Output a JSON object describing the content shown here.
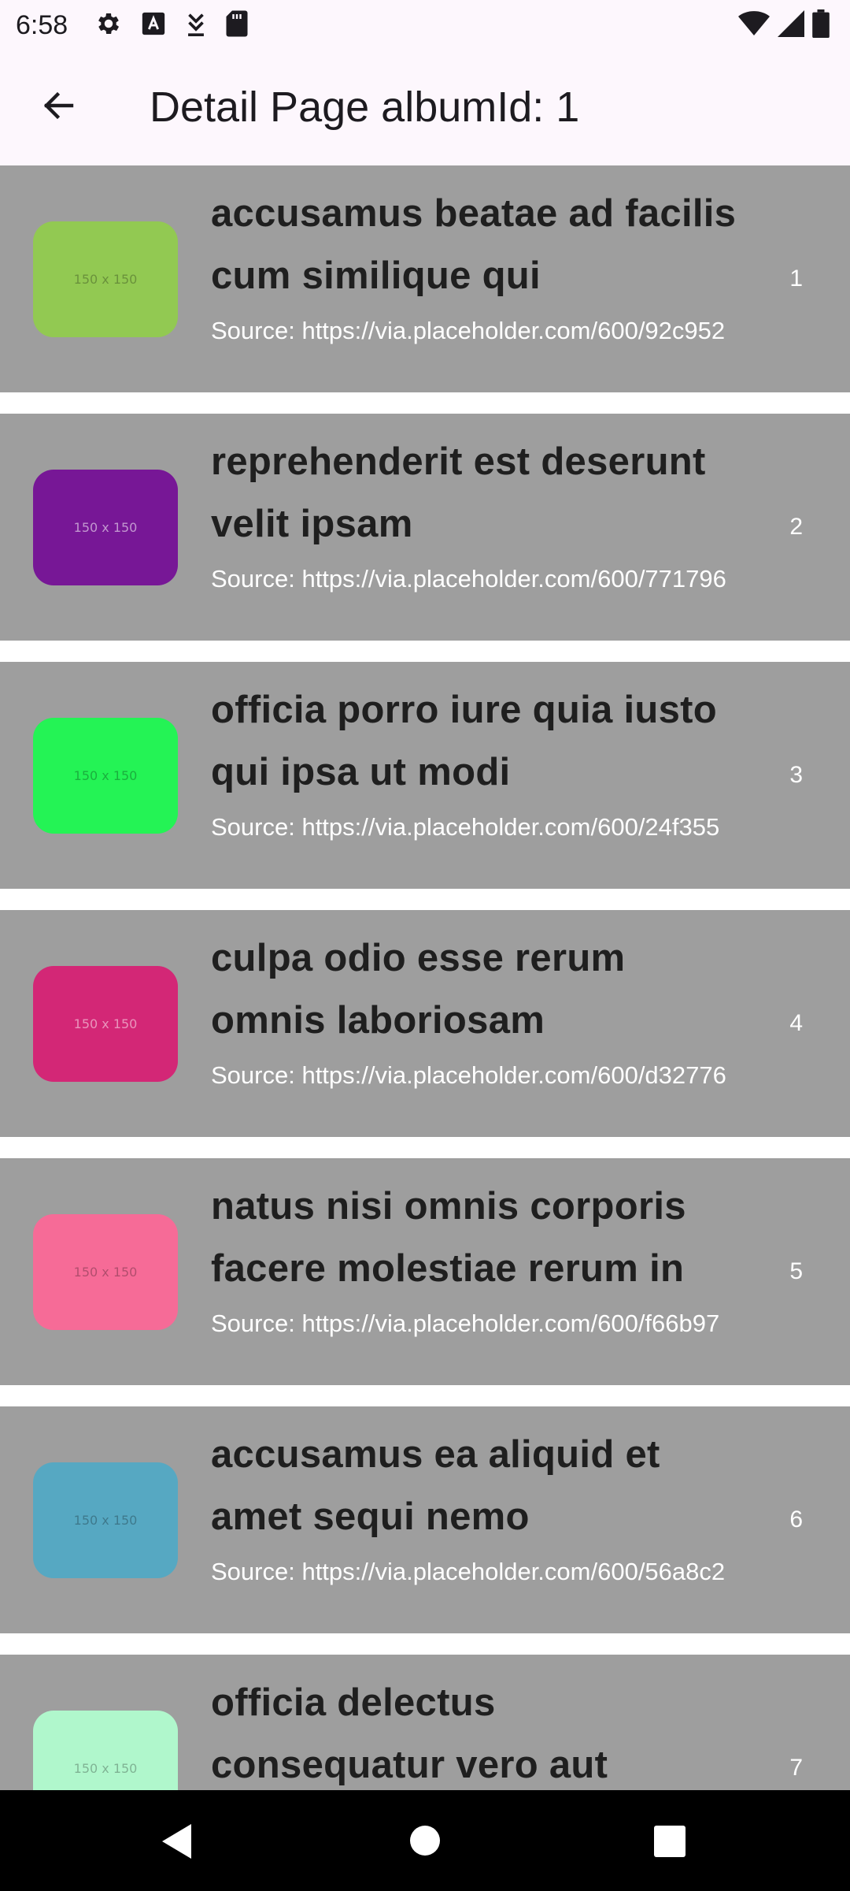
{
  "status_bar": {
    "time": "6:58",
    "left_icons": [
      "settings-icon",
      "font-icon",
      "download-icon",
      "sd-card-icon"
    ],
    "right_icons": [
      "wifi-icon",
      "signal-icon",
      "battery-icon"
    ]
  },
  "app_bar": {
    "title": "Detail Page albumId: 1",
    "back_icon": "arrow-left-icon"
  },
  "items": [
    {
      "title": "accusamus beatae ad facilis cum similique qui",
      "source": "Source: https://via.placeholder.com/600/92c952",
      "number": "1",
      "thumb_color": "#92c952",
      "thumb_text": "150 x 150"
    },
    {
      "title": "reprehenderit est deserunt velit ipsam",
      "source": "Source: https://via.placeholder.com/600/771796",
      "number": "2",
      "thumb_color": "#771796",
      "thumb_text": "150 x 150"
    },
    {
      "title": "officia porro iure quia iusto qui ipsa ut modi",
      "source": "Source: https://via.placeholder.com/600/24f355",
      "number": "3",
      "thumb_color": "#24f355",
      "thumb_text": "150 x 150"
    },
    {
      "title": "culpa odio esse rerum omnis laboriosam",
      "source": "Source: https://via.placeholder.com/600/d32776",
      "number": "4",
      "thumb_color": "#d32776",
      "thumb_text": "150 x 150"
    },
    {
      "title": "natus nisi omnis corporis facere molestiae rerum in",
      "source": "Source: https://via.placeholder.com/600/f66b97",
      "number": "5",
      "thumb_color": "#f66b97",
      "thumb_text": "150 x 150"
    },
    {
      "title": "accusamus ea aliquid et amet sequi nemo",
      "source": "Source: https://via.placeholder.com/600/56a8c2",
      "number": "6",
      "thumb_color": "#56a8c2",
      "thumb_text": "150 x 150"
    },
    {
      "title": "officia delectus consequatur vero aut",
      "source": "",
      "number": "7",
      "thumb_color": "#b0f7cc",
      "thumb_text": "150 x 150"
    }
  ],
  "colors": {
    "card_background": "#9e9e9e",
    "app_bar_background": "#fdf7fd",
    "title_text": "#1f1f1f",
    "secondary_text": "#ffffff"
  },
  "nav_bar": {
    "icons": [
      "nav-back-icon",
      "nav-home-icon",
      "nav-recents-icon"
    ]
  }
}
